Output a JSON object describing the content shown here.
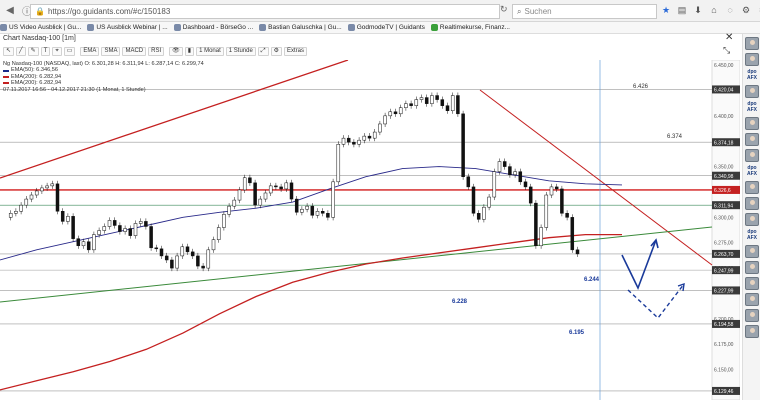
{
  "browser": {
    "url": "https://go.guidants.com/#c/150183",
    "search_placeholder": "Suchen",
    "bookmarks": [
      "US Video Ausblick | Gu...",
      "US Ausblick Webinar | ...",
      "Dashboard - BörseGo ...",
      "Bastian Galuschka | Gu...",
      "GodmodeTV | Guidants",
      "Realtimekurse, Finanz..."
    ]
  },
  "chart": {
    "window_title": "Chart Nasdaq-100 [1m]",
    "toolbar": [
      "EMA",
      "SMA",
      "MACD",
      "RSI",
      "1 Monat",
      "1 Stunde",
      "Extras"
    ],
    "legend": {
      "header": "Ng Nasdaq-100 (NASDAQ, last) O: 6.301,28 H: 6.311,94 L: 6.287,14 C: 6.299,74",
      "lines": [
        "EMA(50): 6.346,56",
        "EMA(200): 6.282,94",
        "EMA(200): 6.282,94"
      ],
      "footer": "07.11.2017 16:56 - 04.12.2017 21:30 (1 Monat, 1 Stunde)",
      "colors": [
        "#1a2a8a",
        "#c42020",
        "#c42020"
      ]
    },
    "y_ticks": [
      "6.450,00",
      "6.400,00",
      "6.350,00",
      "6.300,00",
      "6.275,00",
      "6.250,00",
      "6.200,00",
      "6.175,00",
      "6.150,00"
    ],
    "price_tags": [
      {
        "label": "6.420,04",
        "color": "#3a3a3a"
      },
      {
        "label": "6.374,18",
        "color": "#3a3a3a"
      },
      {
        "label": "6.340,98",
        "color": "#3a3a3a"
      },
      {
        "label": "6.326,6",
        "color": "#c42020"
      },
      {
        "label": "6.311,94",
        "color": "#3a3a3a"
      },
      {
        "label": "6.263,70",
        "color": "#3a3a3a"
      },
      {
        "label": "6.247,99",
        "color": "#3a3a3a"
      },
      {
        "label": "6.227,99",
        "color": "#3a3a3a"
      },
      {
        "label": "6.194,58",
        "color": "#3a3a3a"
      },
      {
        "label": "6.129,46",
        "color": "#3a3a3a"
      }
    ],
    "annotations": {
      "level_6426": "6.426",
      "level_6374": "6.374",
      "level_6244": "6.244",
      "level_6228": "6.228",
      "level_6195": "6.195"
    },
    "accent": "#1a3a9a"
  },
  "chart_data": {
    "type": "line",
    "title": "Chart Nasdaq-100 [1m]",
    "xlabel": "",
    "ylabel": "",
    "ylim": [
      6125,
      6455
    ],
    "grid": true,
    "series": [
      {
        "name": "EMA(50)",
        "color": "#2a2a8a",
        "values": [
          6258,
          6268,
          6276,
          6284,
          6292,
          6300,
          6305,
          6309,
          6315,
          6328,
          6340,
          6348,
          6350,
          6348,
          6342,
          6336,
          6333,
          6332
        ]
      },
      {
        "name": "EMA(200)",
        "color": "#c42020",
        "values": [
          6130,
          6139,
          6148,
          6158,
          6170,
          6186,
          6205,
          6222,
          6236,
          6246,
          6254,
          6260,
          6265,
          6270,
          6275,
          6280,
          6283,
          6283
        ]
      }
    ],
    "levels": [
      6426,
      6374,
      6341,
      6327,
      6312,
      6264,
      6248,
      6228,
      6195,
      6129
    ]
  },
  "sidebar": {
    "logo_label": "dpo\nAFX"
  }
}
